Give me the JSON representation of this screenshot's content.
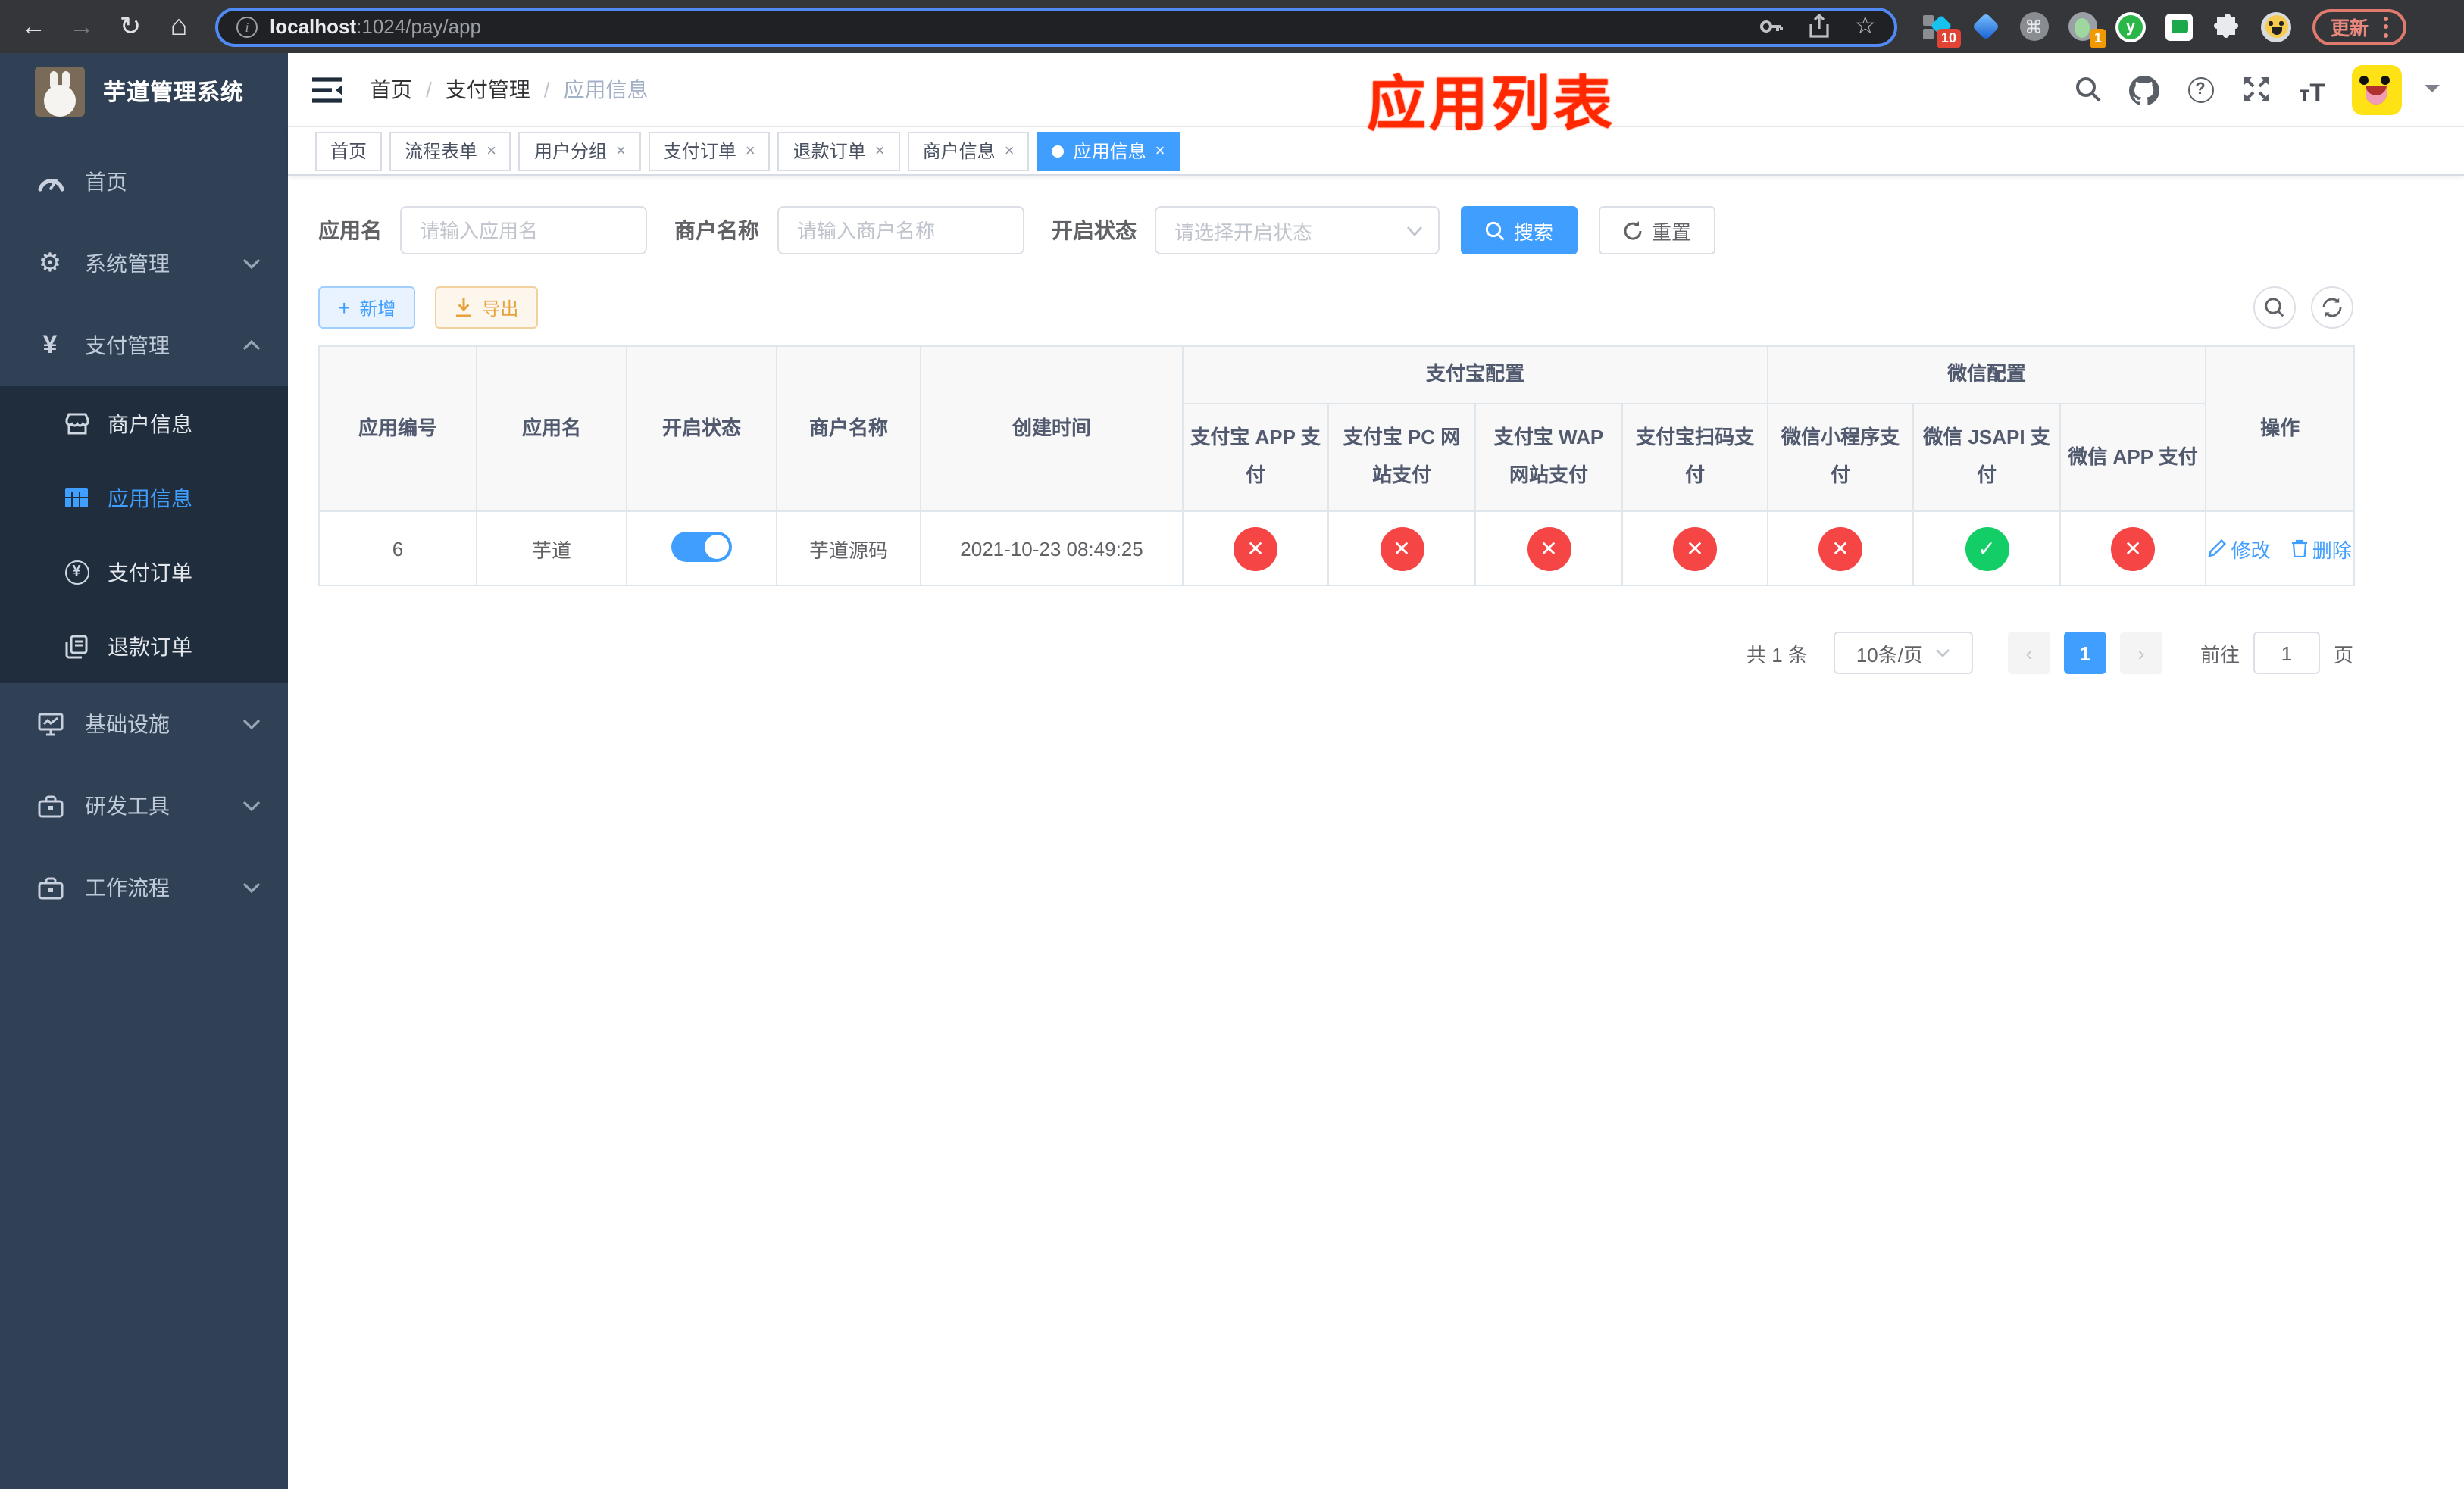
{
  "browser": {
    "url_host": "localhost",
    "url_rest": ":1024/pay/app",
    "update_label": "更新",
    "ext_badge_blue_diamond": "10",
    "ext_badge_avatar": "1",
    "ext_y_letter": "y"
  },
  "sidebar": {
    "title": "芋道管理系统",
    "items": [
      {
        "label": "首页"
      },
      {
        "label": "系统管理"
      },
      {
        "label": "支付管理"
      },
      {
        "label": "基础设施"
      },
      {
        "label": "研发工具"
      },
      {
        "label": "工作流程"
      }
    ],
    "pay_submenu": [
      {
        "label": "商户信息"
      },
      {
        "label": "应用信息"
      },
      {
        "label": "支付订单"
      },
      {
        "label": "退款订单"
      }
    ]
  },
  "header": {
    "breadcrumb": [
      "首页",
      "支付管理",
      "应用信息"
    ],
    "annotation": "应用列表",
    "help_glyph": "?"
  },
  "tabs": [
    {
      "label": "首页"
    },
    {
      "label": "流程表单"
    },
    {
      "label": "用户分组"
    },
    {
      "label": "支付订单"
    },
    {
      "label": "退款订单"
    },
    {
      "label": "商户信息"
    },
    {
      "label": "应用信息"
    }
  ],
  "filters": {
    "app_name_label": "应用名",
    "app_name_placeholder": "请输入应用名",
    "merchant_label": "商户名称",
    "merchant_placeholder": "请输入商户名称",
    "status_label": "开启状态",
    "status_placeholder": "请选择开启状态",
    "search_label": "搜索",
    "reset_label": "重置"
  },
  "toolbar": {
    "add_label": "新增",
    "export_label": "导出"
  },
  "table": {
    "columns": [
      "应用编号",
      "应用名",
      "开启状态",
      "商户名称",
      "创建时间"
    ],
    "groups": [
      {
        "label": "支付宝配置",
        "children": [
          "支付宝 APP 支付",
          "支付宝 PC 网站支付",
          "支付宝 WAP 网站支付",
          "支付宝扫码支付"
        ]
      },
      {
        "label": "微信配置",
        "children": [
          "微信小程序支付",
          "微信 JSAPI 支付",
          "微信 APP 支付"
        ]
      }
    ],
    "op_column": "操作",
    "row": {
      "id": "6",
      "name": "芋道",
      "enabled": true,
      "merchant": "芋道源码",
      "created": "2021-10-23 08:49:25",
      "statuses": [
        "disabled",
        "disabled",
        "disabled",
        "disabled",
        "disabled",
        "enabled",
        "disabled"
      ],
      "edit_label": "修改",
      "delete_label": "删除"
    }
  },
  "pagination": {
    "total": "共 1 条",
    "page_size": "10条/页",
    "current_page": "1",
    "goto_label": "前往",
    "goto_value": "1",
    "page_suffix": "页"
  }
}
